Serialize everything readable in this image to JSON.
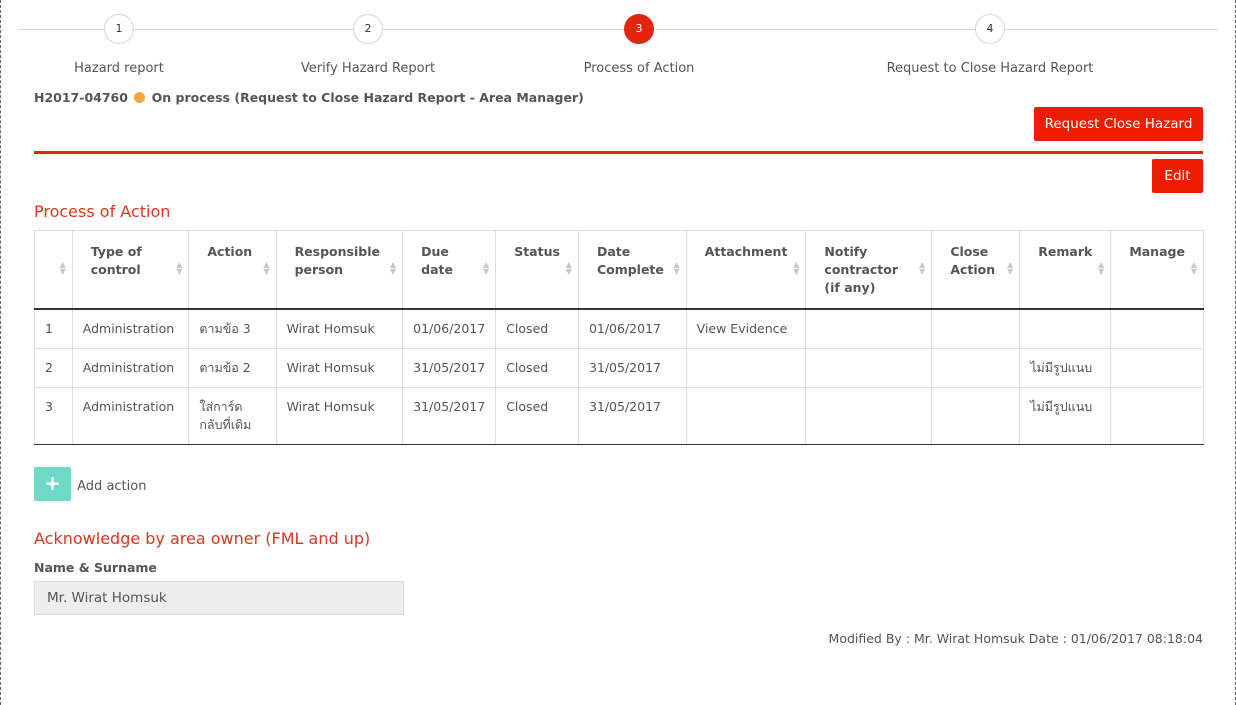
{
  "stepper": {
    "steps": [
      {
        "number": "1",
        "label": "Hazard report"
      },
      {
        "number": "2",
        "label": "Verify Hazard Report"
      },
      {
        "number": "3",
        "label": "Process of Action"
      },
      {
        "number": "4",
        "label": "Request to Close Hazard Report"
      }
    ],
    "active_step": 3
  },
  "hazard": {
    "id": "H2017-04760",
    "status_text": "On process (Request to Close Hazard Report - Area Manager)",
    "status_color": "#f6a540"
  },
  "buttons": {
    "request_close": "Request Close Hazard",
    "edit": "Edit",
    "add_action": "Add action",
    "add_icon": "+"
  },
  "process_section": {
    "title": "Process of Action",
    "columns": [
      "",
      "Type of control",
      "Action",
      "Responsible person",
      "Due date",
      "Status",
      "Date Complete",
      "Attachment",
      "Notify contractor (if any)",
      "Close Action",
      "Remark",
      "Manage"
    ],
    "rows": [
      [
        "1",
        "Administration",
        "ตามข้อ 3",
        "Wirat Homsuk",
        "01/06/2017",
        "Closed",
        "01/06/2017",
        "View Evidence",
        "",
        "",
        "",
        ""
      ],
      [
        "2",
        "Administration",
        "ตามข้อ 2",
        "Wirat Homsuk",
        "31/05/2017",
        "Closed",
        "31/05/2017",
        "",
        "",
        "",
        "ไม่มีรูปแนบ",
        ""
      ],
      [
        "3",
        "Administration",
        "ใส่การ์ดกลับที่เดิม",
        "Wirat Homsuk",
        "31/05/2017",
        "Closed",
        "31/05/2017",
        "",
        "",
        "",
        "ไม่มีรูปแนบ",
        ""
      ]
    ]
  },
  "acknowledge": {
    "title": "Acknowledge by area owner (FML and up)",
    "name_label": "Name & Surname",
    "name_value": "Mr. Wirat Homsuk"
  },
  "footer": {
    "modified": "Modified By : Mr. Wirat Homsuk Date : 01/06/2017 08:18:04"
  },
  "colors": {
    "accent_red": "#e5240e",
    "button_red": "#ee1c00",
    "add_green": "#6ed9c6"
  }
}
